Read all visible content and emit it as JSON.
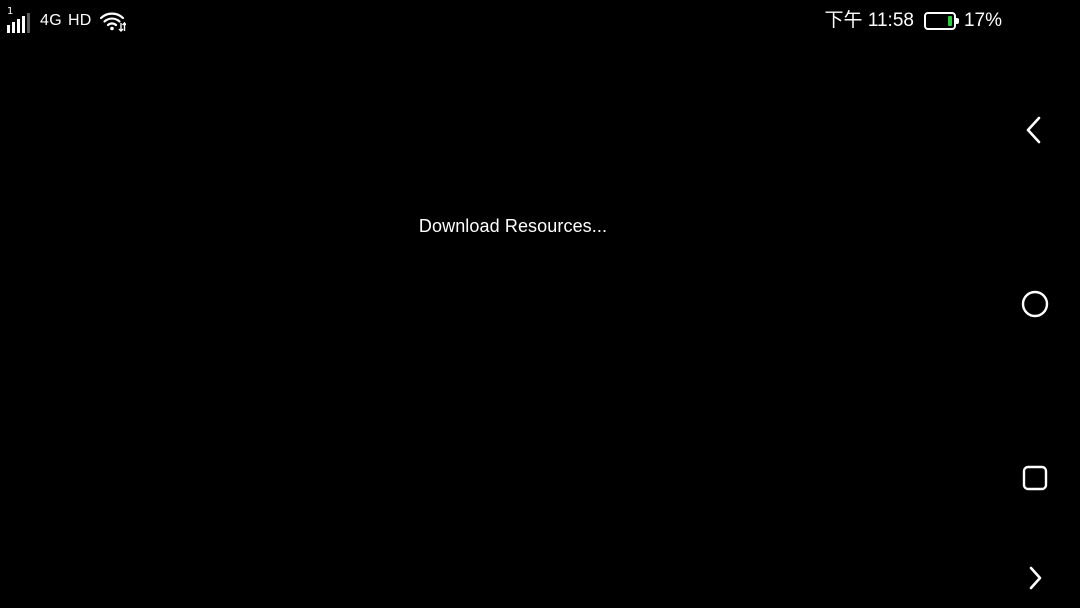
{
  "status_bar": {
    "sim_slot": "1",
    "network_type": "4G",
    "hd_label": "HD",
    "time": "下午 11:58",
    "battery_percent": "17%",
    "battery_level": 0.17,
    "battery_color": "#2ecc40"
  },
  "main": {
    "message": "Download Resources..."
  },
  "nav_bar": {
    "buttons": [
      {
        "icon": "chevron-left-icon"
      },
      {
        "icon": "circle-home-icon"
      },
      {
        "icon": "square-recents-icon"
      },
      {
        "icon": "chevron-right-icon"
      }
    ]
  }
}
